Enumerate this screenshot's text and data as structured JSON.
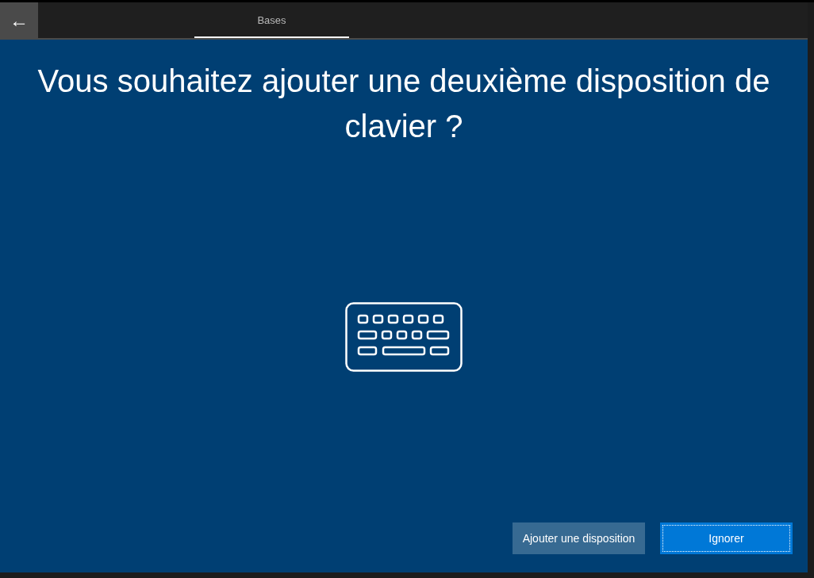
{
  "header": {
    "back_button": {
      "icon": "←"
    },
    "tabs": [
      {
        "label": "Bases",
        "selected": true
      }
    ]
  },
  "title": "Vous souhaitez ajouter une deuxième disposition de clavier ?",
  "buttons": [
    {
      "label": "Ajouter une disposition",
      "kind": "secondary",
      "focused": false
    },
    {
      "label": "Ignorer",
      "kind": "primary",
      "focused": true
    }
  ]
}
